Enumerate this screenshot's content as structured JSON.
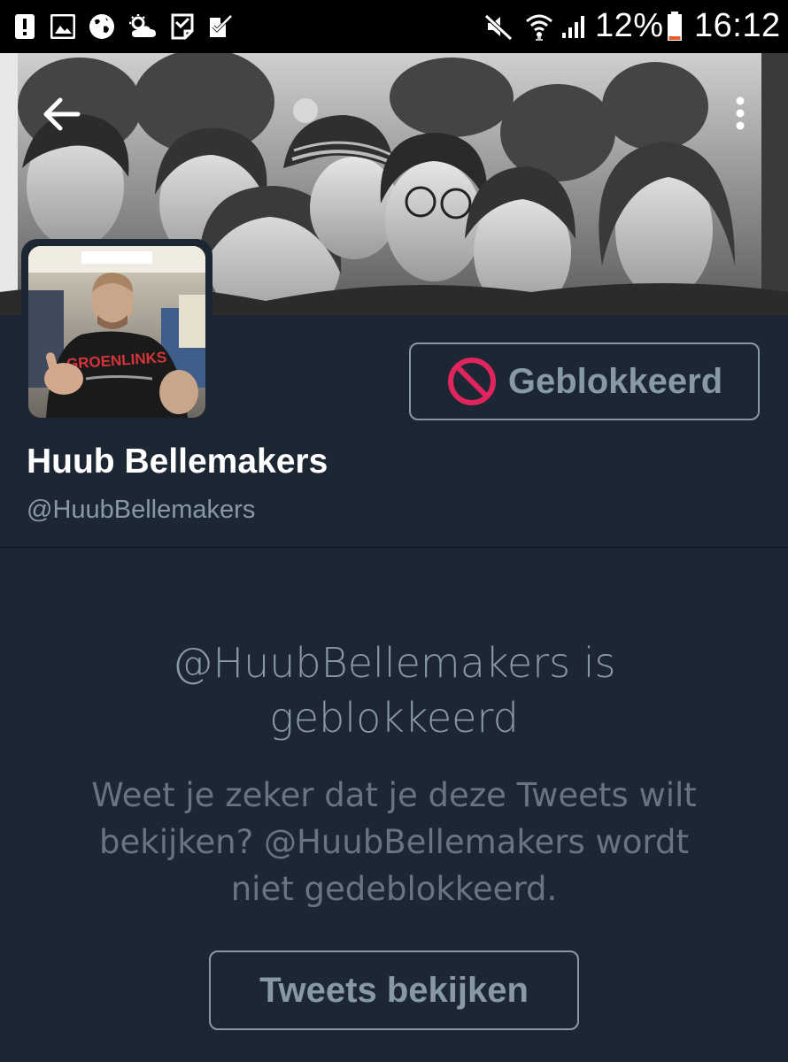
{
  "status_bar": {
    "battery": "12%",
    "time": "16:12",
    "icons": [
      "alert-icon",
      "gallery-icon",
      "globe-icon",
      "weather-icon",
      "task-icon",
      "check-icon",
      "mute-icon",
      "wifi-icon",
      "signal-icon",
      "battery-icon"
    ]
  },
  "header": {
    "back_icon": "arrow-left-icon",
    "menu_icon": "more-vert-icon"
  },
  "profile": {
    "display_name": "Huub Bellemakers",
    "handle": "@HuubBellemakers",
    "avatar_shirt_text": "GROENLINKS",
    "block_button_label": "Geblokkeerd"
  },
  "blocked_notice": {
    "title_line1": "@HuubBellemakers is",
    "title_line2": "geblokkeerd",
    "desc_line1": "Weet je zeker dat je deze Tweets wilt",
    "desc_line2": "bekijken? @HuubBellemakers wordt",
    "desc_line3": "niet gedeblokkeerd.",
    "view_button_label": "Tweets bekijken"
  },
  "colors": {
    "background": "#1c2733",
    "muted_text": "#8899a6",
    "block_red": "#e0245e",
    "status_bar": "#000000"
  }
}
